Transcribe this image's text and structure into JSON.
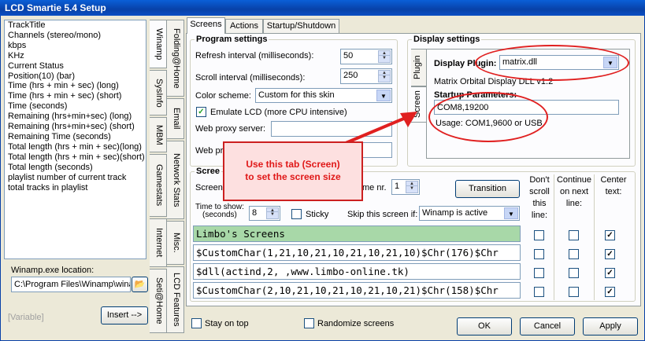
{
  "window": {
    "title": "LCD Smartie 5.4 Setup"
  },
  "left_list": [
    "TrackTitle",
    "Channels (stereo/mono)",
    "kbps",
    "KHz",
    "Current Status",
    "Position(10) (bar)",
    "Time (hrs + min + sec) (long)",
    "Time (hrs + min + sec) (short)",
    "Time (seconds)",
    "Remaining (hrs+min+sec) (long)",
    "Remaining (hrs+min+sec) (short)",
    "Remaining Time (seconds)",
    "Total length (hrs + min + sec)(long)",
    "Total length (hrs + min + sec)(short)",
    "Total length (seconds)",
    "playlist number of current track",
    "total tracks in playlist"
  ],
  "winamp": {
    "label": "Winamp.exe location:",
    "path": "C:\\Program Files\\Winamp\\winamp"
  },
  "variable_label": "[Variable]",
  "insert_button": "Insert -->",
  "vtabs_col1": [
    "Winamp",
    "SysInfo",
    "MBM",
    "Gamestats",
    "Internet",
    "Seti@Home"
  ],
  "vtabs_col2": [
    "Folding@Home",
    "Email",
    "Network Stats",
    "Misc.",
    "LCD Features"
  ],
  "tabs": [
    "Screens",
    "Actions",
    "Startup/Shutdown"
  ],
  "program_settings": {
    "title": "Program settings",
    "refresh_label": "Refresh interval (milliseconds):",
    "refresh_value": "50",
    "scroll_label": "Scroll interval (milliseconds):",
    "scroll_value": "250",
    "color_label": "Color scheme:",
    "color_value": "Custom for this skin",
    "emulate_label": "Emulate LCD  (more CPU intensive)",
    "proxy_label": "Web proxy server:",
    "proxy_port_label": "Web pr"
  },
  "display_settings": {
    "title": "Display settings",
    "tab_plugin": "Plugin",
    "tab_screen": "Screen",
    "plugin_label": "Display Plugin:",
    "plugin_value": "matrix.dll",
    "plugin_desc": "Matrix Orbital Display DLL v1.2",
    "startup_label": "Startup Parameters:",
    "startup_value": "COM8,19200",
    "usage": "Usage: COM1,9600 or USB"
  },
  "screens": {
    "title": "Scree",
    "screen_label": "Screen",
    "theme_label": "me nr.",
    "theme_value": "1",
    "transition": "Transition",
    "time_label": "Time to show:\n(seconds)",
    "time_value": "8",
    "sticky": "Sticky",
    "skip_label": "Skip this screen if:",
    "skip_value": "Winamp is active",
    "col_dont_scroll": "Don't scroll this line:",
    "col_continue": "Continue on next line:",
    "col_center": "Center text:",
    "lines": [
      "Limbo's Screens",
      "$CustomChar(1,21,10,21,10,21,10,21,10)$Chr(176)$Chr",
      "$dll(actind,2, ,www.limbo-online.tk)",
      "$CustomChar(2,10,21,10,21,10,21,10,21)$Chr(158)$Chr"
    ]
  },
  "bottom": {
    "stay_on_top": "Stay on top",
    "randomize": "Randomize screens",
    "ok": "OK",
    "cancel": "Cancel",
    "apply": "Apply"
  },
  "annotation": "Use this tab (Screen)\nto set the screen size",
  "colors": {
    "highlight_line": "#a8d8a8",
    "annotation_red": "#e02020"
  }
}
